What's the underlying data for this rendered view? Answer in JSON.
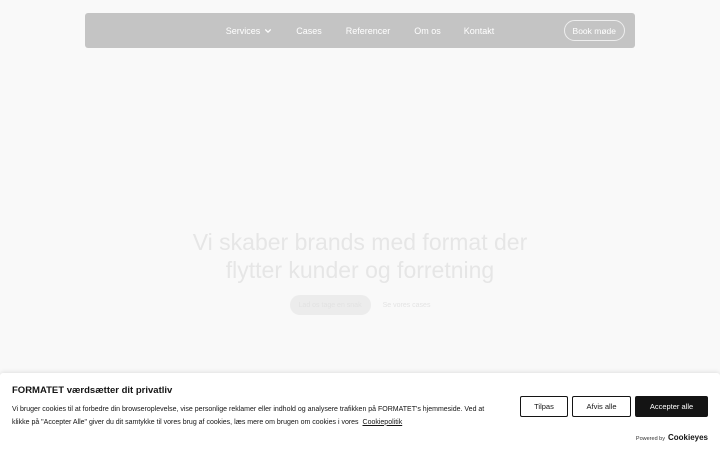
{
  "nav": {
    "links": [
      "Services",
      "Cases",
      "Referencer",
      "Om os",
      "Kontakt"
    ],
    "cta": "Book møde"
  },
  "hero": {
    "title_line1": "Vi skaber brands med format der",
    "title_line2": "flytter kunder og forretning",
    "primary_cta": "Lad os tage en snak",
    "secondary_cta": "Se vores cases"
  },
  "cookie": {
    "title": "FORMATET værdsætter dit privatliv",
    "text_line1": "Vi bruger cookies til at forbedre din browseroplevelse, vise personlige reklamer eller indhold og analysere trafikken på FORMATET's hjemmeside. Ved at",
    "text_line2": "klikke på \"Accepter Alle\" giver du dit samtykke til vores brug af cookies, læs mere om brugen om cookies i vores",
    "policy_link": "Cookiepolitik",
    "buttons": {
      "customize": "Tilpas",
      "reject": "Afvis alle",
      "accept": "Accepter alle"
    },
    "powered_label": "Powered by",
    "powered_brand": "Cookieyes"
  },
  "colors": {
    "nav_bg": "#c4c4c4",
    "page_bg": "#f9f9f9",
    "dark": "#141414"
  }
}
